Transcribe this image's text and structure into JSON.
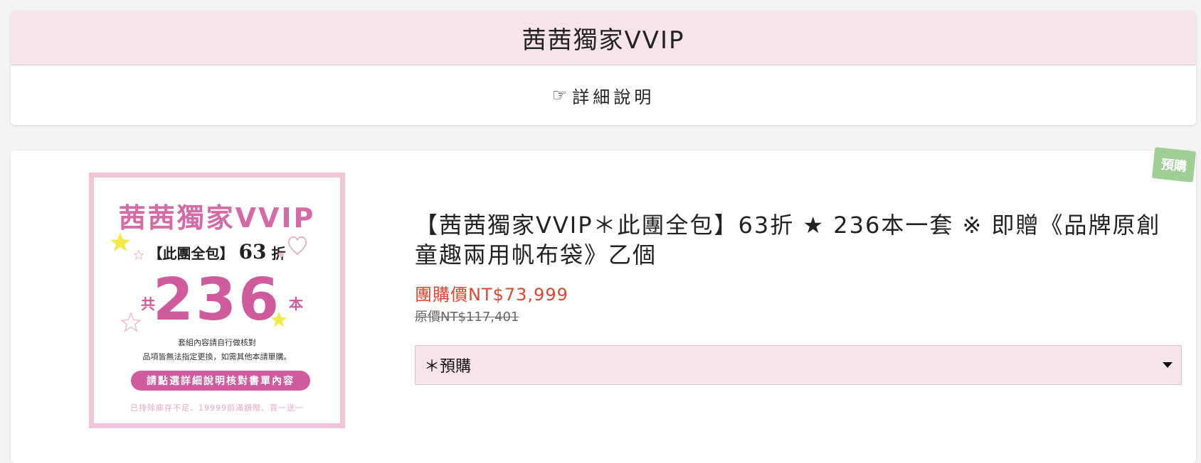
{
  "header": {
    "title": "茜茜獨家VVIP",
    "detail_icon": "pointing-hand-icon",
    "detail_label": "詳細說明"
  },
  "product": {
    "badge": "預購",
    "title": "【茜茜獨家VVIP＊此團全包】63折 ★ 236本一套 ※ 即贈《品牌原創童趣兩用帆布袋》乙個",
    "group_price": "團購價NT$73,999",
    "original_price": "原價NT$117,401",
    "option_selected": "＊預購",
    "image": {
      "title": "茜茜獨家VVIP",
      "sub_bracket": "【此團全包】",
      "sub_discount": "63",
      "sub_unit": "折",
      "gong": "共",
      "count": "236",
      "ben": "本",
      "note_line1": "套組內容請自行做核對",
      "note_line2": "品項皆無法指定更換，如需其他本請單購。",
      "button_text": "請點選詳細說明核對書單內容",
      "footer": "已排除庫存不足、19999前滿額贈、買一送一"
    }
  },
  "colors": {
    "header_bg": "#f7e3ea",
    "price_red": "#e0462f",
    "badge_green": "#9fcf95",
    "brand_pink": "#cf5a9c"
  }
}
